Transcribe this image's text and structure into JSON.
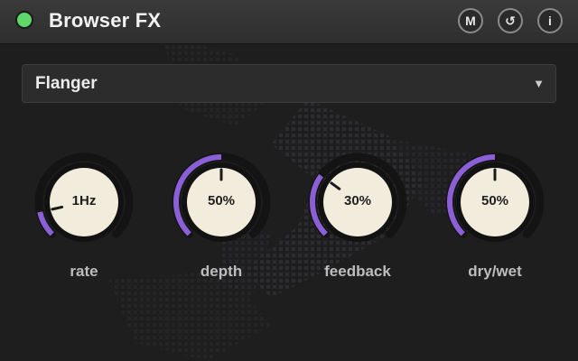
{
  "window": {
    "title": "Browser FX",
    "power_on": true
  },
  "toolbar": {
    "midi_label": "M",
    "reset_label": "↺",
    "info_label": "i"
  },
  "preset": {
    "selected": "Flanger",
    "caret": "▼"
  },
  "knobs": [
    {
      "id": "rate",
      "label": "rate",
      "display": "1Hz",
      "value_fraction": 0.12
    },
    {
      "id": "depth",
      "label": "depth",
      "display": "50%",
      "value_fraction": 0.5
    },
    {
      "id": "feedback",
      "label": "feedback",
      "display": "30%",
      "value_fraction": 0.3
    },
    {
      "id": "drywet",
      "label": "dry/wet",
      "display": "50%",
      "value_fraction": 0.5
    }
  ],
  "colors": {
    "accent": "#8b5fd6",
    "power_led": "#5fd86a",
    "knob_face": "#f1ecdc",
    "track": "#141414",
    "background": "#1e1e1e"
  }
}
